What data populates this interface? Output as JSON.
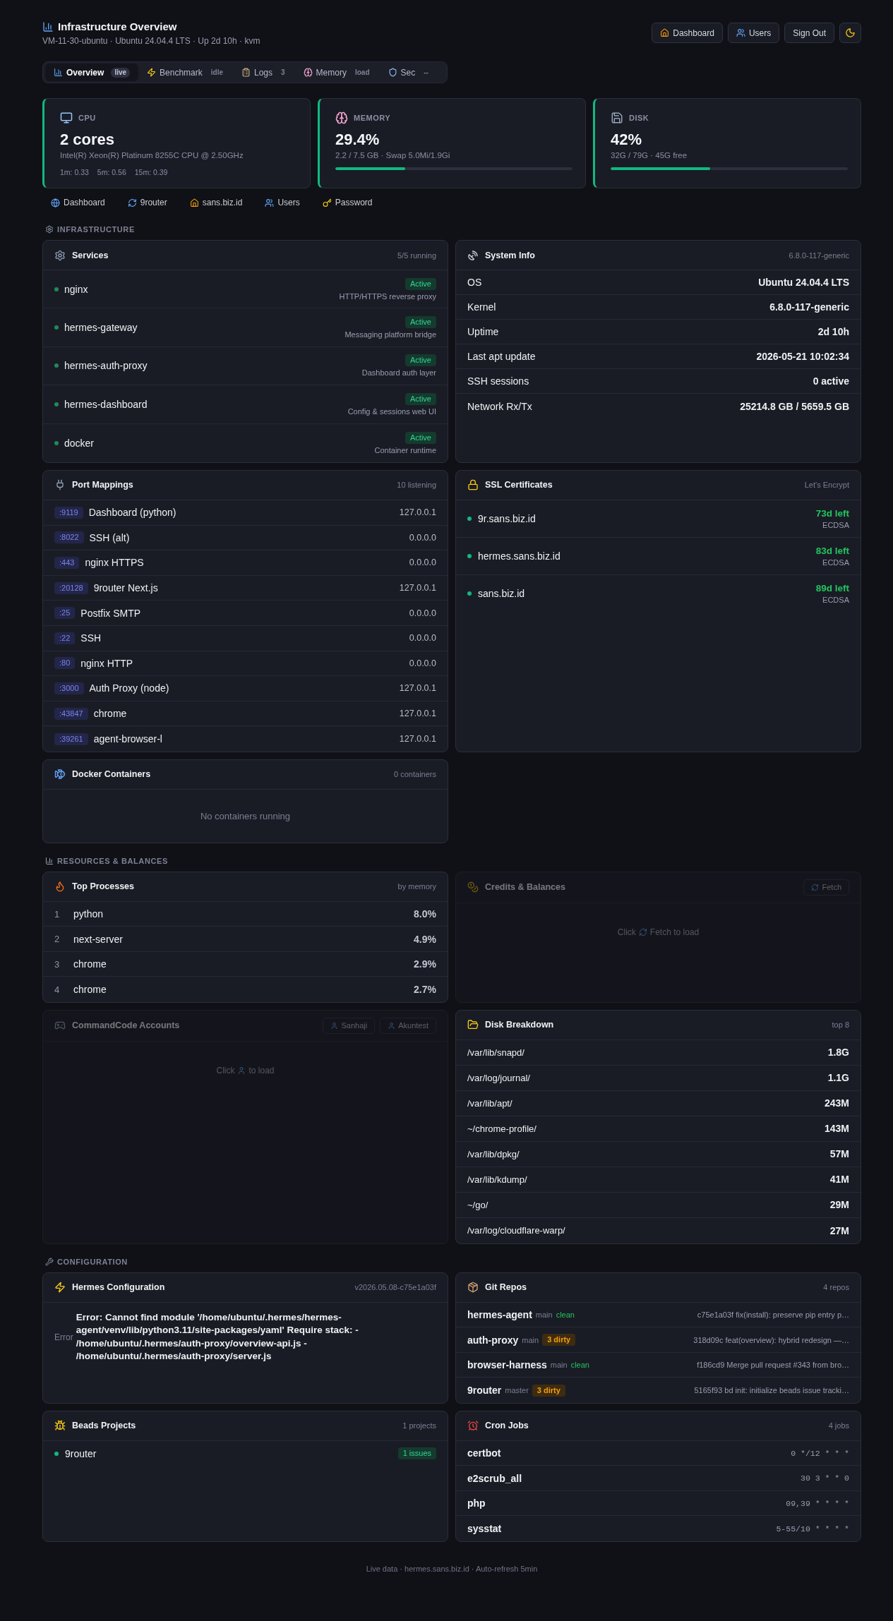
{
  "header": {
    "title": "Infrastructure Overview",
    "subtitle": "VM-11-30-ubuntu · Ubuntu 24.04.4 LTS · Up 2d 10h · kvm",
    "nav_links": [
      {
        "label": "Dashboard"
      },
      {
        "label": "Users"
      }
    ],
    "sign_out": "Sign Out"
  },
  "tabs": [
    {
      "label": "Overview",
      "badge": "live",
      "selected": true
    },
    {
      "label": "Benchmark",
      "badge": "idle",
      "selected": false
    },
    {
      "label": "Logs",
      "badge": "3",
      "selected": false
    },
    {
      "label": "Memory",
      "badge": "load",
      "selected": false
    },
    {
      "label": "Sec",
      "badge": "--",
      "selected": false
    }
  ],
  "stats": [
    {
      "kind": "loads",
      "label": "CPU",
      "value": "2 cores",
      "detail": "Intel(R) Xeon(R) Platinum 8255C CPU @ 2.50GHz",
      "loads": [
        "1m: 0.33",
        "5m: 0.56",
        "15m: 0.39"
      ]
    },
    {
      "kind": "bar",
      "label": "MEMORY",
      "value": "29.4%",
      "detail": "2.2 / 7.5 GB · Swap 5.0Mi/1.9Gi",
      "level": 0.294
    },
    {
      "kind": "bar",
      "label": "DISK",
      "value": "42%",
      "detail": "32G / 79G · 45G free",
      "level": 0.42
    }
  ],
  "quick_links": [
    {
      "label": "Dashboard"
    },
    {
      "label": "9router"
    },
    {
      "label": "sans.biz.id"
    },
    {
      "label": "Users"
    },
    {
      "label": "Password"
    }
  ],
  "infrastructure": {
    "label": "INFRASTRUCTURE",
    "services": {
      "title": "Services",
      "meta": "5/5 running",
      "items": [
        {
          "name": "nginx",
          "status": "Active",
          "description": "HTTP/HTTPS reverse proxy",
          "active": true
        },
        {
          "name": "hermes-gateway",
          "status": "Active",
          "description": "Messaging platform bridge",
          "active": true
        },
        {
          "name": "hermes-auth-proxy",
          "status": "Active",
          "description": "Dashboard auth layer",
          "active": true
        },
        {
          "name": "hermes-dashboard",
          "status": "Active",
          "description": "Config & sessions web UI",
          "active": true
        },
        {
          "name": "docker",
          "status": "Active",
          "description": "Container runtime",
          "active": true
        }
      ]
    },
    "system_info": {
      "title": "System Info",
      "meta": "6.8.0-117-generic",
      "rows": [
        {
          "label": "OS",
          "value": "Ubuntu 24.04.4 LTS"
        },
        {
          "label": "Kernel",
          "value": "6.8.0-117-generic"
        },
        {
          "label": "Uptime",
          "value": "2d 10h"
        },
        {
          "label": "Last apt update",
          "value": "2026-05-21 10:02:34"
        },
        {
          "label": "SSH sessions",
          "value": "0 active"
        },
        {
          "label": "Network Rx/Tx",
          "value": "25214.8 GB / 5659.5 GB"
        }
      ]
    },
    "port_mappings": {
      "title": "Port Mappings",
      "meta": "10 listening",
      "rows": [
        {
          "port": ":9119",
          "name": "Dashboard (python)",
          "address": "127.0.0.1"
        },
        {
          "port": ":8022",
          "name": "SSH (alt)",
          "address": "0.0.0.0"
        },
        {
          "port": ":443",
          "name": "nginx HTTPS",
          "address": "0.0.0.0"
        },
        {
          "port": ":20128",
          "name": "9router Next.js",
          "address": "127.0.0.1"
        },
        {
          "port": ":25",
          "name": "Postfix SMTP",
          "address": "0.0.0.0"
        },
        {
          "port": ":22",
          "name": "SSH",
          "address": "0.0.0.0"
        },
        {
          "port": ":80",
          "name": "nginx HTTP",
          "address": "0.0.0.0"
        },
        {
          "port": ":3000",
          "name": "Auth Proxy (node)",
          "address": "127.0.0.1"
        },
        {
          "port": ":43847",
          "name": "chrome",
          "address": "127.0.0.1"
        },
        {
          "port": ":39261",
          "name": "agent-browser-l",
          "address": "127.0.0.1"
        }
      ]
    },
    "ssl_certificates": {
      "title": "SSL Certificates",
      "meta": "Let's Encrypt",
      "items": [
        {
          "domain": "9r.sans.biz.id",
          "remaining": "73d left",
          "key_type": "ECDSA",
          "valid": true
        },
        {
          "domain": "hermes.sans.biz.id",
          "remaining": "83d left",
          "key_type": "ECDSA",
          "valid": true
        },
        {
          "domain": "sans.biz.id",
          "remaining": "89d left",
          "key_type": "ECDSA",
          "valid": true
        }
      ]
    },
    "docker_containers": {
      "title": "Docker Containers",
      "meta": "0 containers",
      "empty": "No containers running"
    }
  },
  "resources": {
    "label": "RESOURCES & BALANCES",
    "top_processes": {
      "title": "Top Processes",
      "meta": "by memory",
      "rows": [
        {
          "rank": "1",
          "name": "python",
          "value": "8.0%"
        },
        {
          "rank": "2",
          "name": "next-server",
          "value": "4.9%"
        },
        {
          "rank": "3",
          "name": "chrome",
          "value": "2.9%"
        },
        {
          "rank": "4",
          "name": "chrome",
          "value": "2.7%"
        }
      ]
    },
    "credits_balances": {
      "title": "Credits & Balances",
      "loaded": false,
      "button": "Fetch",
      "hint": {
        "before": "Click",
        "after": "Fetch to load"
      }
    },
    "commandcode_accounts": {
      "title": "CommandCode Accounts",
      "loaded": false,
      "buttons": [
        "Sanhaji",
        "Akuntest"
      ],
      "hint": {
        "before": "Click",
        "after": "to load"
      }
    },
    "disk_breakdown": {
      "title": "Disk Breakdown",
      "meta": "top 8",
      "rows": [
        {
          "path": "/var/lib/snapd/",
          "size": "1.8G"
        },
        {
          "path": "/var/log/journal/",
          "size": "1.1G"
        },
        {
          "path": "/var/lib/apt/",
          "size": "243M"
        },
        {
          "path": "~/chrome-profile/",
          "size": "143M"
        },
        {
          "path": "/var/lib/dpkg/",
          "size": "57M"
        },
        {
          "path": "/var/lib/kdump/",
          "size": "41M"
        },
        {
          "path": "~/go/",
          "size": "29M"
        },
        {
          "path": "/var/log/cloudflare-warp/",
          "size": "27M"
        }
      ]
    }
  },
  "configuration": {
    "label": "CONFIGURATION",
    "hermes_configuration": {
      "title": "Hermes Configuration",
      "meta": "v2026.05.08-c75e1a03f",
      "rows": [
        {
          "label": "Error",
          "value": "Error: Cannot find module '/home/ubuntu/.hermes/hermes-agent/venv/lib/python3.11/site-packages/yaml' Require stack: - /home/ubuntu/.hermes/auth-proxy/overview-api.js - /home/ubuntu/.hermes/auth-proxy/server.js"
        }
      ]
    },
    "git_repos": {
      "title": "Git Repos",
      "meta": "4 repos",
      "repos": [
        {
          "name": "hermes-agent",
          "branch": "main",
          "status": "clean",
          "dirty": false,
          "commit": "c75e1a03f fix(install): preserve pip entry p…"
        },
        {
          "name": "auth-proxy",
          "branch": "main",
          "status": "3 dirty",
          "dirty": true,
          "commit": "318d09c feat(overview): hybrid redesign —…"
        },
        {
          "name": "browser-harness",
          "branch": "main",
          "status": "clean",
          "dirty": false,
          "commit": "f186cd9 Merge pull request #343 from bro…"
        },
        {
          "name": "9router",
          "branch": "master",
          "status": "3 dirty",
          "dirty": true,
          "commit": "5165f93 bd init: initialize beads issue tracki…"
        }
      ]
    },
    "beads_projects": {
      "title": "Beads Projects",
      "meta": "1 projects",
      "items": [
        {
          "name": "9router",
          "issues": "1 issues",
          "active": true
        }
      ]
    },
    "cron_jobs": {
      "title": "Cron Jobs",
      "meta": "4 jobs",
      "jobs": [
        {
          "name": "certbot",
          "schedule": "0 */12 * * *"
        },
        {
          "name": "e2scrub_all",
          "schedule": "30 3 * * 0"
        },
        {
          "name": "php",
          "schedule": "09,39 * * * *"
        },
        {
          "name": "sysstat",
          "schedule": "5-55/10 * * * *"
        }
      ]
    }
  },
  "footer": "Live data · hermes.sans.biz.id · Auto-refresh 5min"
}
